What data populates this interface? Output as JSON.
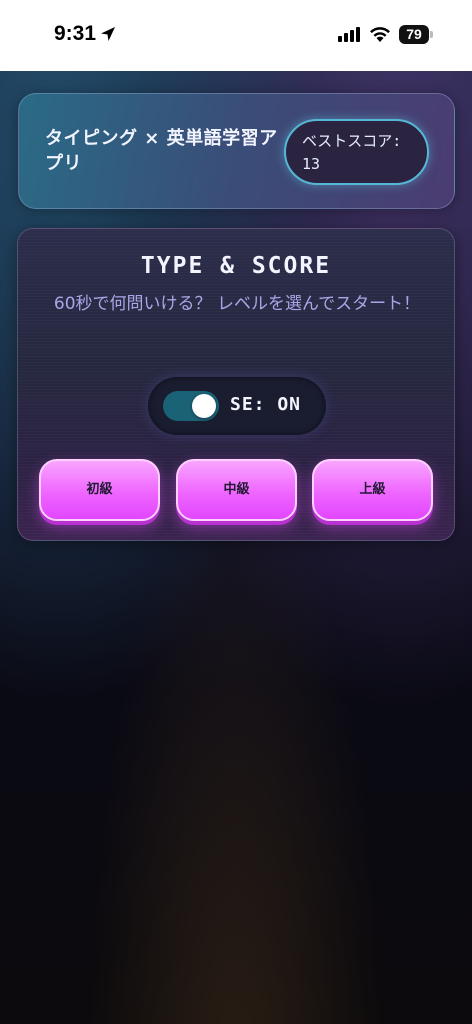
{
  "status_bar": {
    "time": "9:31",
    "battery": "79",
    "icons": [
      "location-arrow-icon",
      "cellular-signal-icon",
      "wifi-icon",
      "battery-icon"
    ]
  },
  "header": {
    "app_title": "タイピング × 英単語学習アプリ",
    "best_score_label": "ベストスコア:",
    "best_score_value": "13"
  },
  "main": {
    "title": "TYPE & SCORE",
    "subtitle": "60秒で何問いける？ レベルを選んでスタート！",
    "sound_toggle": {
      "label": "SE: ON",
      "on": true
    },
    "levels": [
      {
        "label": "初級"
      },
      {
        "label": "中級"
      },
      {
        "label": "上級"
      }
    ]
  },
  "colors": {
    "accent_pink": "#ef66ff",
    "toggle_on": "#1a6275",
    "pill_border": "#57b6d6",
    "subtitle_text": "#a9a6e8"
  }
}
